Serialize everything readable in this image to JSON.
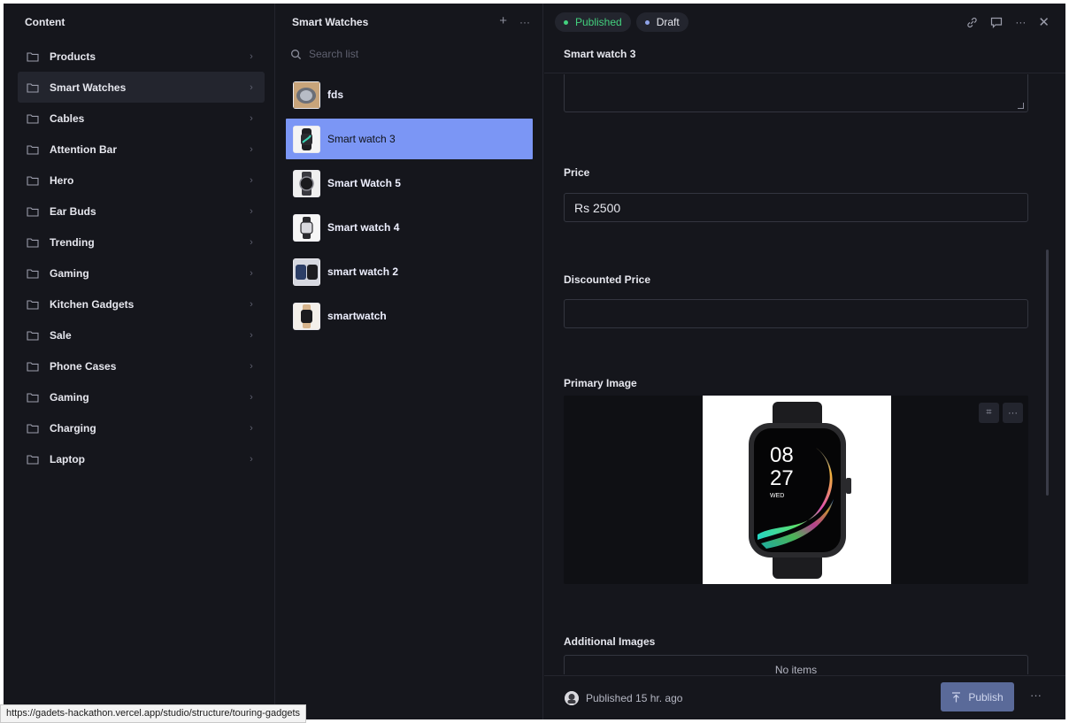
{
  "content_pane": {
    "title": "Content",
    "items": [
      {
        "label": "Products"
      },
      {
        "label": "Smart Watches",
        "active": true
      },
      {
        "label": "Cables"
      },
      {
        "label": "Attention Bar"
      },
      {
        "label": "Hero"
      },
      {
        "label": "Ear Buds"
      },
      {
        "label": "Trending"
      },
      {
        "label": "Gaming"
      },
      {
        "label": "Kitchen Gadgets"
      },
      {
        "label": "Sale"
      },
      {
        "label": "Phone Cases"
      },
      {
        "label": "Gaming"
      },
      {
        "label": "Charging"
      },
      {
        "label": "Laptop"
      }
    ]
  },
  "list_pane": {
    "title": "Smart Watches",
    "add_icon": "plus-icon",
    "more_icon": "ellipsis-icon",
    "search_placeholder": "Search list",
    "documents": [
      {
        "label": "fds"
      },
      {
        "label": "Smart watch 3",
        "active": true
      },
      {
        "label": "Smart Watch 5"
      },
      {
        "label": "Smart watch 4"
      },
      {
        "label": "smart watch 2"
      },
      {
        "label": "smartwatch"
      }
    ]
  },
  "editor": {
    "status": {
      "published": "Published",
      "draft": "Draft"
    },
    "document_title": "Smart watch 3",
    "fields": {
      "price_label": "Price",
      "price_value": "Rs 2500",
      "discounted_label": "Discounted Price",
      "discounted_value": "",
      "primary_image_label": "Primary Image",
      "additional_images_label": "Additional Images",
      "additional_images_empty": "No items"
    },
    "watch_face": {
      "hour": "08",
      "minute": "27",
      "day": "WED"
    },
    "footer": {
      "published_status": "Published 15 hr. ago",
      "publish_button": "Publish"
    }
  },
  "url_tooltip": "https://gadets-hackathon.vercel.app/studio/structure/touring-gadgets",
  "colors": {
    "background": "#15161c",
    "selected_doc": "#7b96f5",
    "published": "#43d17e",
    "publish_button": "#5a6a99"
  }
}
